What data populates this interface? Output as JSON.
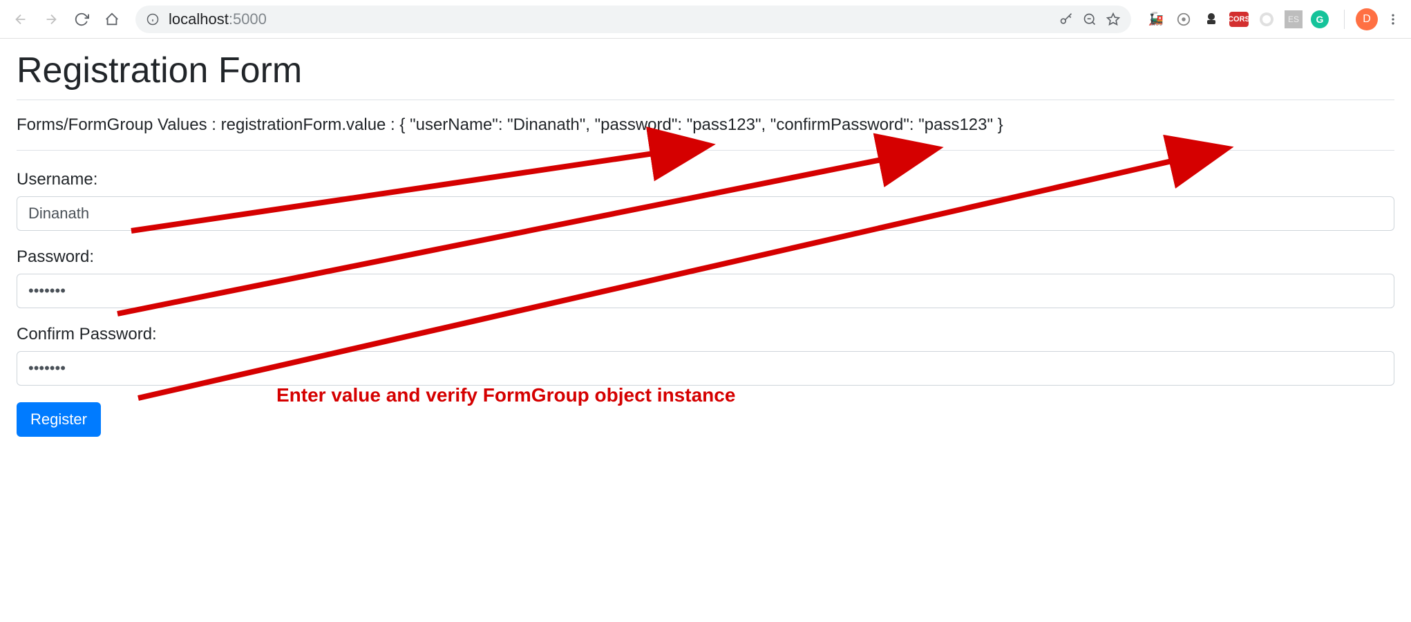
{
  "browser": {
    "url_host": "localhost",
    "url_port": ":5000",
    "avatar_letter": "D",
    "cors_label": "CORS",
    "es_label": "ES",
    "grammarly_label": "G"
  },
  "page": {
    "title": "Registration Form",
    "values_line": "Forms/FormGroup Values : registrationForm.value : { \"userName\": \"Dinanath\", \"password\": \"pass123\", \"confirmPassword\": \"pass123\" }",
    "form": {
      "username_label": "Username:",
      "username_value": "Dinanath",
      "password_label": "Password:",
      "password_value": "pass123",
      "confirm_label": "Confirm Password:",
      "confirm_value": "pass123",
      "register_label": "Register"
    },
    "annotation": "Enter value and verify FormGroup object instance"
  }
}
